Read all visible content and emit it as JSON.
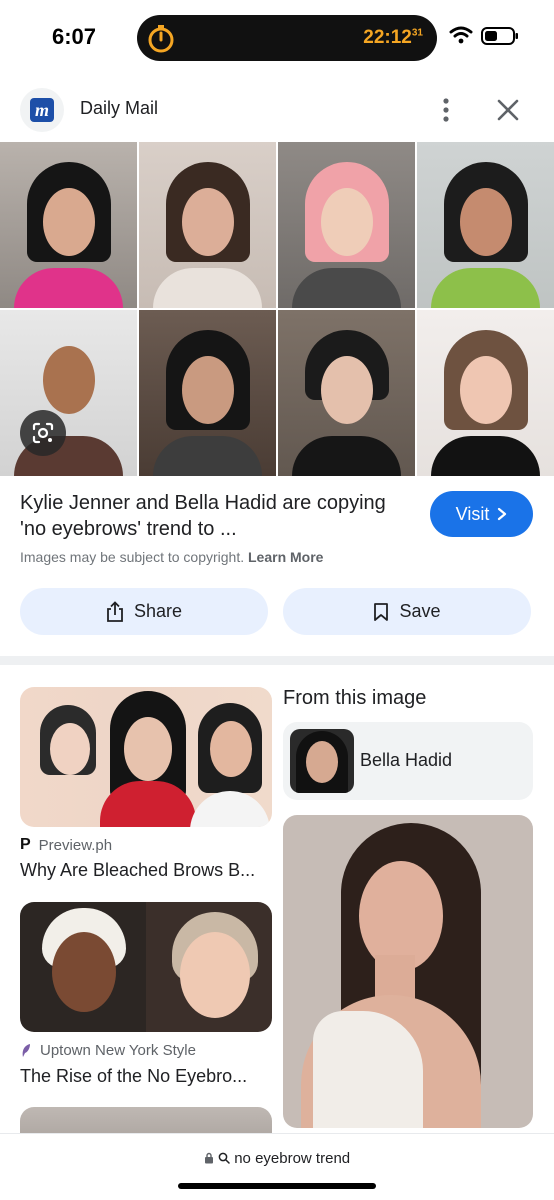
{
  "status_bar": {
    "time": "6:07",
    "timer_main": "22:12",
    "timer_sub": "31"
  },
  "source": {
    "logo_letter": "m",
    "name": "Daily Mail"
  },
  "result": {
    "title": "Kylie Jenner and Bella Hadid are copying 'no eyebrows' trend to ...",
    "visit_label": "Visit",
    "copyright_text": "Images may be subject to copyright.",
    "learn_more": "Learn More",
    "share_label": "Share",
    "save_label": "Save"
  },
  "related": [
    {
      "source": "Preview.ph",
      "source_icon": "P",
      "title": "Why Are Bleached Brows B..."
    },
    {
      "source": "Uptown New York Style",
      "source_icon": "feather-icon",
      "title": "The Rise of the No Eyebro..."
    }
  ],
  "from_image": {
    "heading": "From this image",
    "entity": "Bella Hadid"
  },
  "url_bar": {
    "query": "no eyebrow trend"
  },
  "colors": {
    "accent": "#1a73e8",
    "chip_bg": "#e8f0fe"
  }
}
